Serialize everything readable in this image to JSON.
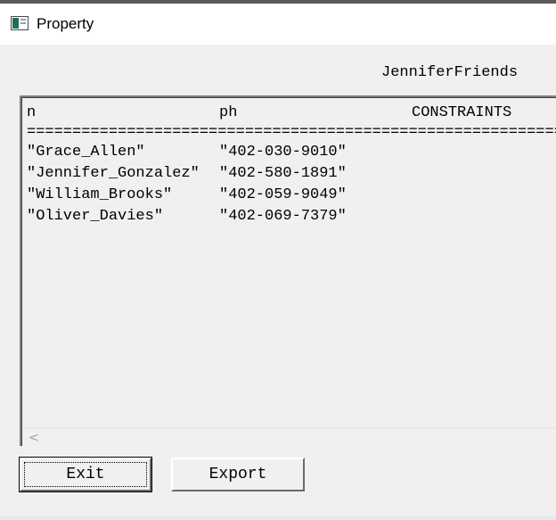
{
  "window": {
    "title": "Property",
    "icon": "app-window-icon"
  },
  "relation_name": "JenniferFriends",
  "table": {
    "headers": [
      "n",
      "ph",
      "CONSTRAINTS"
    ],
    "separator": "====================================================================",
    "rows": [
      [
        "\"Grace_Allen\"",
        "\"402-030-9010\""
      ],
      [
        "\"Jennifer_Gonzalez\"",
        "\"402-580-1891\""
      ],
      [
        "\"William_Brooks\"",
        "\"402-059-9049\""
      ],
      [
        "\"Oliver_Davies\"",
        "\"402-069-7379\""
      ]
    ]
  },
  "scrollbar": {
    "left_arrow": "<"
  },
  "buttons": {
    "exit_label": "Exit",
    "export_label": "Export"
  }
}
